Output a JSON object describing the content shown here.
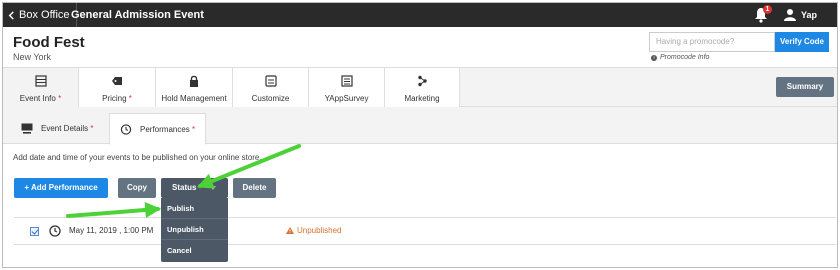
{
  "topbar": {
    "back_label": "Box Office",
    "event_label": "General Admission Event",
    "notification_count": "1",
    "user_name": "Yap Test"
  },
  "header": {
    "title": "Food Fest",
    "location": "New York",
    "promo_placeholder": "Having a promocode?",
    "verify_label": "Verify Code",
    "promo_info": "Promocode Info"
  },
  "main_tabs": [
    {
      "label": "Event Info",
      "required": "*",
      "icon": "grid-icon"
    },
    {
      "label": "Pricing",
      "required": "*",
      "icon": "tag-icon"
    },
    {
      "label": "Hold Management",
      "required": "",
      "icon": "lock-icon"
    },
    {
      "label": "Customize",
      "required": "",
      "icon": "window-icon"
    },
    {
      "label": "YAppSurvey",
      "required": "",
      "icon": "list-icon"
    },
    {
      "label": "Marketing",
      "required": "",
      "icon": "share-icon"
    }
  ],
  "summary_label": "Summary",
  "sub_tabs": [
    {
      "label": "Event Details",
      "required": "*"
    },
    {
      "label": "Performances",
      "required": "*"
    }
  ],
  "description": "Add date and time of your events to be published on your online store.",
  "actions": {
    "add_label": "Add Performance",
    "copy_label": "Copy",
    "status_label": "Status",
    "delete_label": "Delete"
  },
  "status_menu": [
    "Publish",
    "Unpublish",
    "Cancel"
  ],
  "performance": {
    "date": "May 11, 2019 , 1:00 PM",
    "status": "Unpublished",
    "checked": true
  },
  "colors": {
    "topbar": "#2a2a2a",
    "primary": "#1e88e5",
    "secondary": "#637381",
    "warning": "#d9702b",
    "arrow": "#4cd137"
  }
}
